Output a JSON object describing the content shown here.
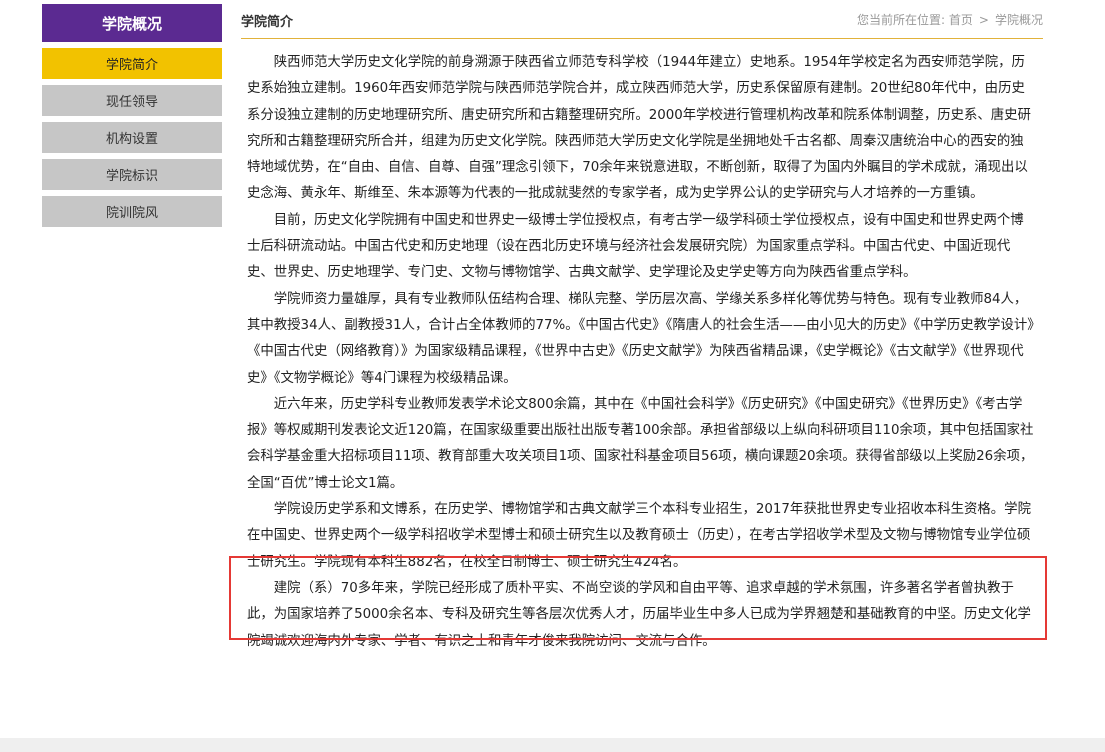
{
  "sidebar": {
    "title": "学院概况",
    "items": [
      {
        "label": "学院简介",
        "active": true
      },
      {
        "label": "现任领导",
        "active": false
      },
      {
        "label": "机构设置",
        "active": false
      },
      {
        "label": "学院标识",
        "active": false
      },
      {
        "label": "院训院风",
        "active": false
      }
    ]
  },
  "main": {
    "title": "学院简介",
    "breadcrumb": {
      "prefix": "您当前所在位置:",
      "home": "首页",
      "separator": ">",
      "current": "学院概况"
    },
    "paragraphs": [
      "陕西师范大学历史文化学院的前身溯源于陕西省立师范专科学校（1944年建立）史地系。1954年学校定名为西安师范学院，历史系始独立建制。1960年西安师范学院与陕西师范学院合并，成立陕西师范大学，历史系保留原有建制。20世纪80年代中，由历史系分设独立建制的历史地理研究所、唐史研究所和古籍整理研究所。2000年学校进行管理机构改革和院系体制调整，历史系、唐史研究所和古籍整理研究所合并，组建为历史文化学院。陕西师范大学历史文化学院是坐拥地处千古名都、周秦汉唐统治中心的西安的独特地域优势，在“自由、自信、自尊、自强”理念引领下，70余年来锐意进取，不断创新，取得了为国内外瞩目的学术成就，涌现出以史念海、黄永年、斯维至、朱本源等为代表的一批成就斐然的专家学者，成为史学界公认的史学研究与人才培养的一方重镇。",
      "目前，历史文化学院拥有中国史和世界史一级博士学位授权点，有考古学一级学科硕士学位授权点，设有中国史和世界史两个博士后科研流动站。中国古代史和历史地理（设在西北历史环境与经济社会发展研究院）为国家重点学科。中国古代史、中国近现代史、世界史、历史地理学、专门史、文物与博物馆学、古典文献学、史学理论及史学史等方向为陕西省重点学科。",
      "学院师资力量雄厚，具有专业教师队伍结构合理、梯队完整、学历层次高、学缘关系多样化等优势与特色。现有专业教师84人，其中教授34人、副教授31人，合计占全体教师的77%。《中国古代史》《隋唐人的社会生活——由小见大的历史》《中学历史教学设计》《中国古代史（网络教育）》为国家级精品课程，《世界中古史》《历史文献学》为陕西省精品课，《史学概论》《古文献学》《世界现代史》《文物学概论》等4门课程为校级精品课。",
      "近六年来，历史学科专业教师发表学术论文800余篇，其中在《中国社会科学》《历史研究》《中国史研究》《世界历史》《考古学报》等权威期刊发表论文近120篇，在国家级重要出版社出版专著100余部。承担省部级以上纵向科研项目110余项，其中包括国家社会科学基金重大招标项目11项、教育部重大攻关项目1项、国家社科基金项目56项，横向课题20余项。获得省部级以上奖励26余项，全国“百优”博士论文1篇。",
      "学院设历史学系和文博系，在历史学、博物馆学和古典文献学三个本科专业招生，2017年获批世界史专业招收本科生资格。学院在中国史、世界史两个一级学科招收学术型博士和硕士研究生以及教育硕士（历史），在考古学招收学术型及文物与博物馆专业学位硕士研究生。学院现有本科生882名，在校全日制博士、硕士研究生424名。",
      "建院（系）70多年来，学院已经形成了质朴平实、不尚空谈的学风和自由平等、追求卓越的学术氛围，许多著名学者曾执教于此，为国家培养了5000余名本、专科及研究生等各层次优秀人才，历届毕业生中多人已成为学界翘楚和基础教育的中坚。历史文化学院竭诚欢迎海内外专家、学者、有识之士和青年才俊来我院访问、交流与合作。"
    ]
  },
  "colors": {
    "sidebar_title_bg": "#5b2a91",
    "active_item_bg": "#f2c200",
    "inactive_item_bg": "#c6c6c6",
    "header_rule": "#e1b23a",
    "highlight_border": "#e53935"
  }
}
